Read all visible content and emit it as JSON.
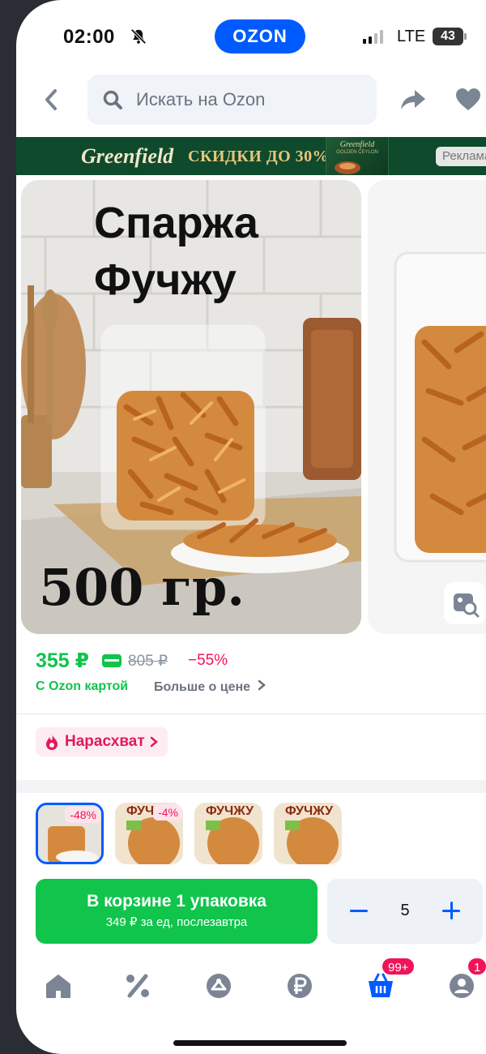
{
  "status_bar": {
    "time": "02:00",
    "carrier": "LTE",
    "battery": "43",
    "app_logo": "OZON"
  },
  "header": {
    "search_placeholder": "Искать на Ozon"
  },
  "banner": {
    "brand": "Greenfield",
    "text": "СКИДКИ ДО 30%",
    "box_brand": "Greenfield",
    "box_subtitle": "GOLDEN CEYLON",
    "ad_label": "Реклама"
  },
  "gallery": {
    "title_line1": "Спаржа",
    "title_line2": "Фучжу",
    "weight": "500 гр."
  },
  "pricing": {
    "current": "355 ₽",
    "old": "805 ₽",
    "discount": "−55%",
    "card_note": "С Ozon картой",
    "more_link": "Больше о цене"
  },
  "badge": {
    "label": "Нарасхват"
  },
  "variants": [
    {
      "discount": "-48%",
      "text": ""
    },
    {
      "discount": "-4%",
      "text": "ФУЧ"
    },
    {
      "discount": "",
      "text": "ФУЧЖУ"
    },
    {
      "discount": "",
      "text": "ФУЧЖУ"
    }
  ],
  "cart": {
    "title": "В корзине 1 упаковка",
    "subtitle": "349 ₽ за ед, послезавтра",
    "quantity": "5"
  },
  "tabbar": {
    "cart_badge": "99+",
    "profile_badge": "1"
  },
  "colors": {
    "ozon_blue": "#005bff",
    "price_green": "#10c44c",
    "discount_pink": "#f91155"
  }
}
